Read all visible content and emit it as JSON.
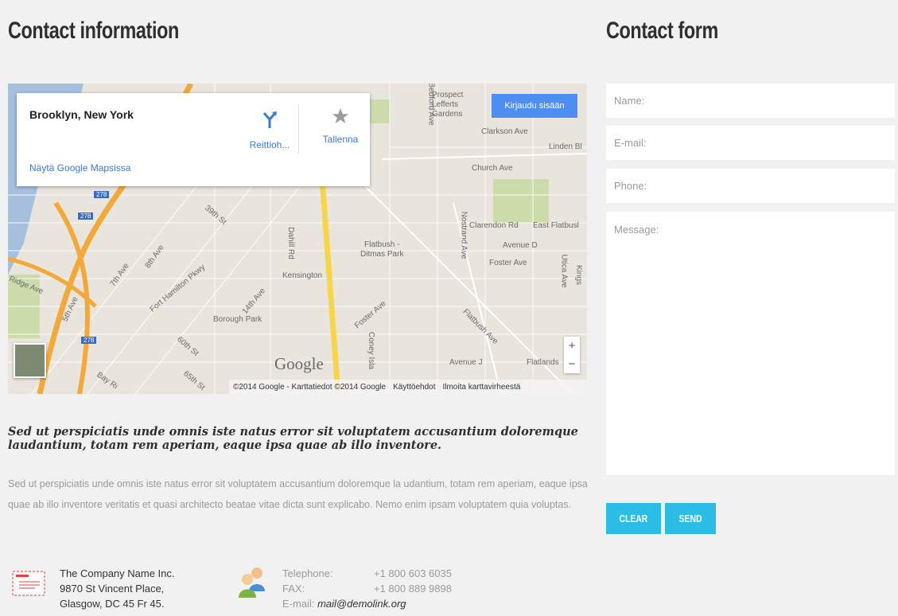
{
  "left": {
    "title": "Contact information"
  },
  "right": {
    "title": "Contact form"
  },
  "map": {
    "place_name": "Brooklyn, New York",
    "route_label": "Reittioh...",
    "save_label": "Tallenna",
    "open_in_maps": "Näytä Google Mapsissa",
    "signin_label": "Kirjaudu sisään",
    "zoom_in": "+",
    "zoom_out": "−",
    "google_logo": "Google",
    "attribution": "©2014 Google - Karttatiedot ©2014 Google",
    "terms": "Käyttöehdot",
    "report": "Ilmoita karttavirheestä",
    "labels": {
      "prospect": "Prospect",
      "lefferts": "Lefferts",
      "gardens": "Gardens",
      "bedford": "Bedford Ave",
      "clarkson": "Clarkson Ave",
      "linden": "Linden Bl",
      "church": "Church Ave",
      "clarendon": "Clarendon Rd",
      "east_flatbush": "East Flatbusl",
      "avenue_d": "Avenue D",
      "foster_ave": "Foster Ave",
      "flatbush_ditmas1": "Flatbush -",
      "flatbush_ditmas2": "Ditmas Park",
      "kensington": "Kensington",
      "dahill": "Dahill Rd",
      "nostrand": "Nostrand Ave",
      "utica": "Utica Ave",
      "kings": "Kings",
      "borough_park": "Borough Park",
      "ridge_ave": "Ridge Ave",
      "fifth_ave": "5th Ave",
      "seventh_ave": "7th Ave",
      "eighth_ave": "8th Ave",
      "fort_hamilton": "Fort Hamilton Pkwy",
      "fourteenth_ave": "14th Ave",
      "thirtyninth": "39th St",
      "sixtieth": "60th St",
      "sixtyfifth": "65th St",
      "bay_ridge": "Bay Ri",
      "foster_ave2": "Foster Ave",
      "coney": "Coney Isla",
      "flatbush_ave": "Flatbush Ave",
      "avenue_j": "Avenue J",
      "flatlands": "Flatlands",
      "shield_278a": "278",
      "shield_278b": "278",
      "shield_278c": "278"
    }
  },
  "lead": "Sed ut perspiciatis unde omnis iste natus error sit voluptatem accusantium doloremque laudantium, totam rem aperiam, eaque ipsa quae ab illo inventore.",
  "body": "Sed ut perspiciatis unde omnis iste natus error sit voluptatem accusantium doloremque la udantium, totam rem aperiam, eaque ipsa quae ab illo inventore veritatis et quasi architecto beatae vitae dicta sunt explicabo. Nemo enim ipsam voluptatem quia voluptas.",
  "address": {
    "icon": "envelope-icon",
    "line1": "The Company Name Inc.",
    "line2": "9870 St Vincent Place,",
    "line3": "Glasgow, DC 45 Fr 45."
  },
  "contacts": {
    "icon": "people-icon",
    "tel_label": "Telephone:",
    "tel_value": "+1 800 603 6035",
    "fax_label": "FAX:",
    "fax_value": "+1 800 889 9898",
    "email_label": "E-mail:",
    "email_value": "mail@demolink.org"
  },
  "form": {
    "name_placeholder": "Name:",
    "email_placeholder": "E-mail:",
    "phone_placeholder": "Phone:",
    "message_placeholder": "Message:",
    "clear_label": "CLEAR",
    "send_label": "SEND"
  },
  "colors": {
    "accent": "#2bbde6",
    "link": "#3a7bd5",
    "signin": "#4d8ef0",
    "background": "#f1f1f1"
  }
}
